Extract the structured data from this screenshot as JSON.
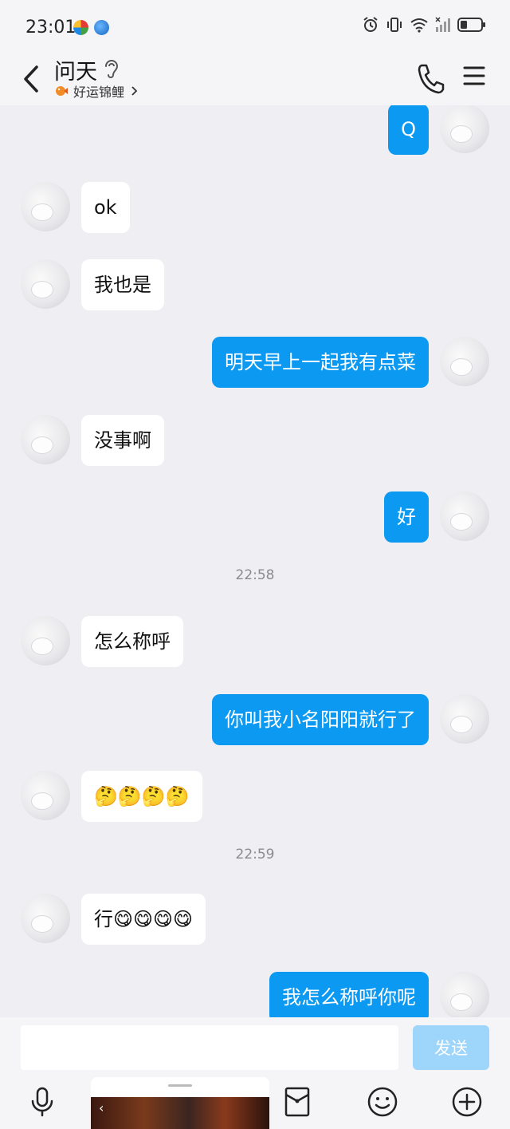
{
  "status_bar": {
    "time": "23:01"
  },
  "header": {
    "title": "问天",
    "subtitle": "好运锦鲤"
  },
  "messages": [
    {
      "side": "out",
      "text": "Q"
    },
    {
      "side": "in",
      "text": "ok"
    },
    {
      "side": "in",
      "text": "我也是"
    },
    {
      "side": "out",
      "text": "明天早上一起我有点菜"
    },
    {
      "side": "in",
      "text": "没事啊"
    },
    {
      "side": "out",
      "text": "好"
    },
    {
      "time": "22:58"
    },
    {
      "side": "in",
      "text": "怎么称呼"
    },
    {
      "side": "out",
      "text": "你叫我小名阳阳就行了"
    },
    {
      "side": "in",
      "text": "🤔🤔🤔🤔"
    },
    {
      "time": "22:59"
    },
    {
      "side": "in",
      "text": "行😋😋😋😋"
    },
    {
      "side": "out",
      "text": "我怎么称呼你呢"
    }
  ],
  "input": {
    "placeholder": "",
    "send_label": "发送"
  },
  "colors": {
    "outgoing_bubble": "#0c99f2",
    "incoming_bubble": "#ffffff",
    "background": "#eeeef3",
    "send_button": "#9dd5fb"
  },
  "toolbar": [
    "microphone-icon",
    "image-icon",
    "red-packet-icon",
    "emoji-icon",
    "plus-icon"
  ]
}
